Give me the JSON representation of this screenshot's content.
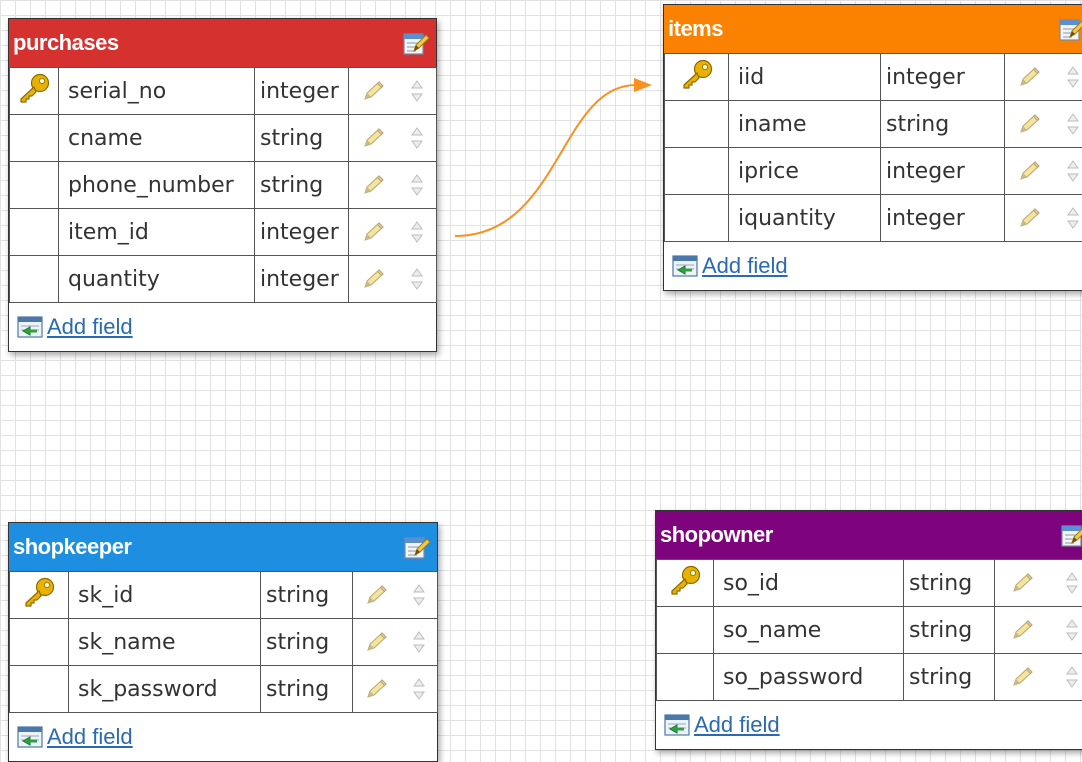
{
  "add_field_label": "Add field",
  "colors": {
    "purchases": "#d4312f",
    "items": "#fa8200",
    "shopkeeper": "#1e8fe0",
    "shopowner": "#7e047e",
    "relation": "#fa9020"
  },
  "tables": {
    "purchases": {
      "name": "purchases",
      "fields": [
        {
          "name": "serial_no",
          "type": "integer",
          "key": true
        },
        {
          "name": "cname",
          "type": "string",
          "key": false
        },
        {
          "name": "phone_number",
          "type": "string",
          "key": false
        },
        {
          "name": "item_id",
          "type": "integer",
          "key": false
        },
        {
          "name": "quantity",
          "type": "integer",
          "key": false
        }
      ]
    },
    "items": {
      "name": "items",
      "fields": [
        {
          "name": "iid",
          "type": "integer",
          "key": true
        },
        {
          "name": "iname",
          "type": "string",
          "key": false
        },
        {
          "name": "iprice",
          "type": "integer",
          "key": false
        },
        {
          "name": "iquantity",
          "type": "integer",
          "key": false
        }
      ]
    },
    "shopkeeper": {
      "name": "shopkeeper",
      "fields": [
        {
          "name": "sk_id",
          "type": "string",
          "key": true
        },
        {
          "name": "sk_name",
          "type": "string",
          "key": false
        },
        {
          "name": "sk_password",
          "type": "string",
          "key": false
        }
      ]
    },
    "shopowner": {
      "name": "shopowner",
      "fields": [
        {
          "name": "so_id",
          "type": "string",
          "key": true
        },
        {
          "name": "so_name",
          "type": "string",
          "key": false
        },
        {
          "name": "so_password",
          "type": "string",
          "key": false
        }
      ]
    }
  },
  "relations": [
    {
      "from": "purchases.item_id",
      "to": "items.iid"
    }
  ]
}
